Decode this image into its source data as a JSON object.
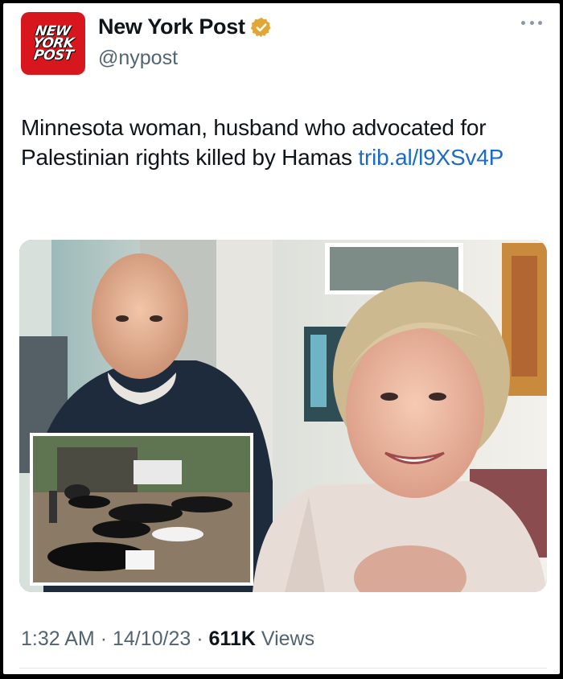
{
  "account": {
    "logo_lines": [
      "NEW",
      "YORK",
      "POST"
    ],
    "name": "New York Post",
    "handle": "@nypost"
  },
  "tweet": {
    "text": "Minnesota woman, husband who advocated for Palestinian rights killed by Hamas ",
    "link": "trib.al/l9XSv4P"
  },
  "footer": {
    "time": "1:32 AM",
    "date": "14/10/23",
    "views_count": "611K",
    "views_label": "Views"
  },
  "icons": {
    "verified": "verified-badge-icon",
    "more": "more-options-icon"
  },
  "colors": {
    "logo_red": "#d7161e",
    "verified_gold": "#e2a634",
    "link_blue": "#1d6bc7"
  }
}
